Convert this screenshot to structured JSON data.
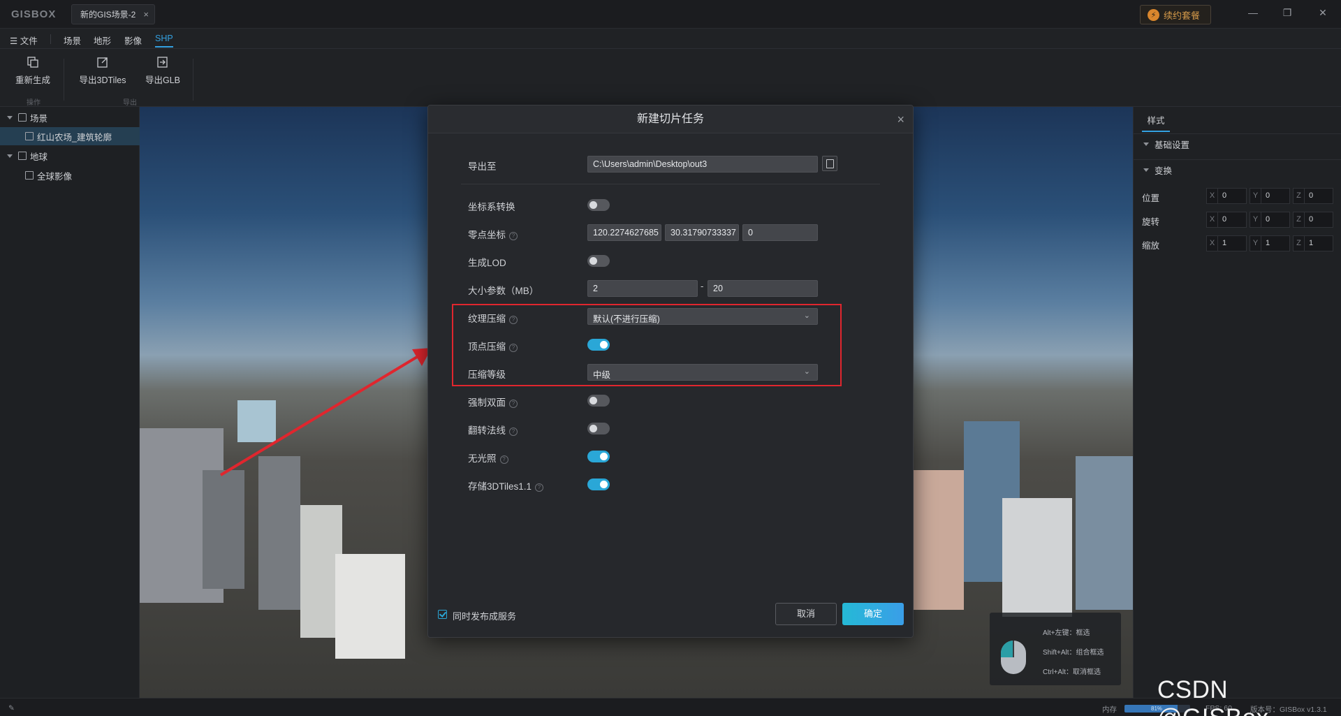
{
  "titlebar": {
    "logo": "GISBOX",
    "doc_tab": "新的GIS场景-2",
    "doc_tab_close": "×",
    "renew": "续约套餐",
    "min": "—",
    "restore": "❐",
    "close": "✕"
  },
  "menubar": {
    "file": "文件",
    "items": [
      "场景",
      "地形",
      "影像",
      "SHP"
    ]
  },
  "ribbon": {
    "regenerate": "重新生成",
    "export_3dtiles": "导出3DTiles",
    "export_glb": "导出GLB",
    "group_ops": "操作",
    "group_export": "导出"
  },
  "tree": {
    "scene": "场景",
    "scene_item": "红山农场_建筑轮廓",
    "earth": "地球",
    "earth_item": "全球影像"
  },
  "right_panel": {
    "tab": "样式",
    "basic": "基础设置",
    "transform": "变换",
    "rows": [
      {
        "label": "位置",
        "x": "0",
        "y": "0",
        "z": "0"
      },
      {
        "label": "旋转",
        "x": "0",
        "y": "0",
        "z": "0"
      },
      {
        "label": "缩放",
        "x": "1",
        "y": "1",
        "z": "1"
      }
    ],
    "axis_x": "X",
    "axis_y": "Y",
    "axis_z": "Z"
  },
  "modal": {
    "title": "新建切片任务",
    "close": "×",
    "export_to_label": "导出至",
    "export_path": "C:\\Users\\admin\\Desktop\\out3",
    "crs_label": "坐标系转换",
    "origin_label": "零点坐标",
    "origin_x": "120.2274627685",
    "origin_y": "30.31790733337",
    "origin_z": "0",
    "lod_label": "生成LOD",
    "size_label": "大小参数（MB）",
    "size_min": "2",
    "size_sep": "-",
    "size_max": "20",
    "texture_label": "纹理压缩",
    "texture_value": "默认(不进行压缩)",
    "vertex_label": "顶点压缩",
    "level_label": "压缩等级",
    "level_value": "中级",
    "double_label": "强制双面",
    "flip_label": "翻转法线",
    "unlit_label": "无光照",
    "tiles11_label": "存储3DTiles1.1",
    "publish_label": "同时发布成服务",
    "cancel": "取消",
    "ok": "确定",
    "help_glyph": "?"
  },
  "toggles": {
    "crs": false,
    "lod": false,
    "vertex": true,
    "double": false,
    "flip": false,
    "unlit": true,
    "tiles11": true
  },
  "hint": {
    "l1": "Alt+左键：框选",
    "l2": "Shift+Alt：组合框选",
    "l3": "Ctrl+Alt：取消框选"
  },
  "status": {
    "memory_label": "内存",
    "memory_pct": "81%",
    "memory_fraction": 0.81,
    "fps": "FPS: 60",
    "version": "版本号：GISBox v1.3.1"
  },
  "watermark": "CSDN @GISBox",
  "colors": {
    "accent": "#2aa7d7",
    "highlight_box": "#e0262e",
    "arrow": "#e0262e"
  }
}
